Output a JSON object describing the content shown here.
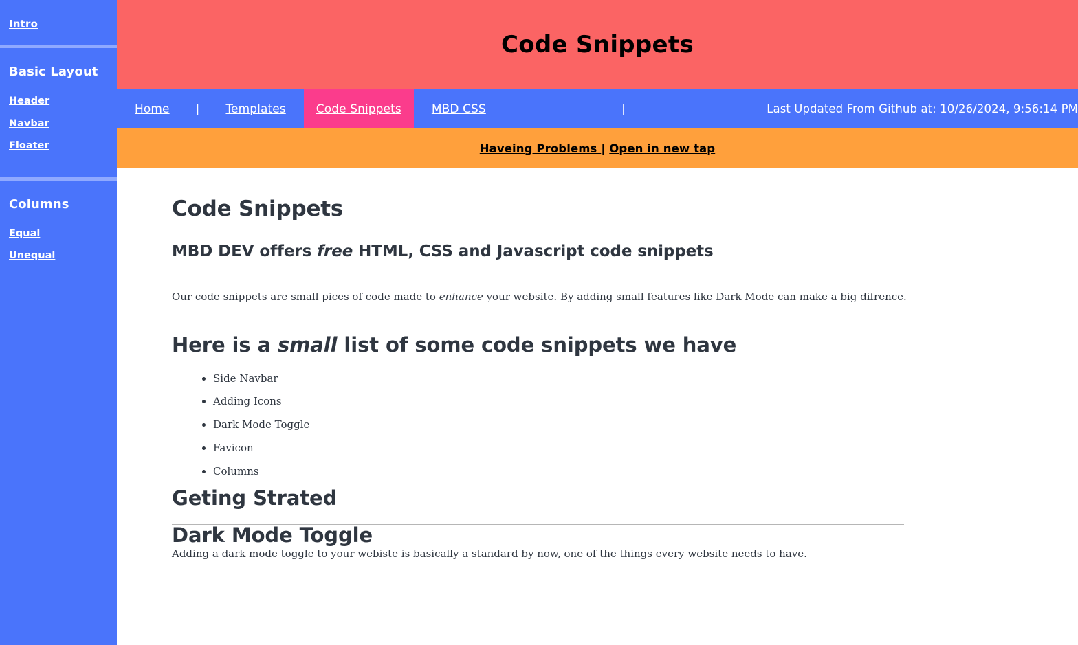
{
  "colors": {
    "sidebar_bg": "#4a74fb",
    "sidebar_divider": "#8fa9ff",
    "header_bg": "#fb6464",
    "navbar_bg": "#4a74fb",
    "nav_active_bg": "#fb3c8c",
    "banner_bg": "#ffa03c",
    "text_dark": "#2f3640",
    "rule": "#b6b6b6"
  },
  "sidebar": {
    "intro_label": "Intro",
    "groups": [
      {
        "heading": "Basic Layout",
        "items": [
          "Header",
          "Navbar",
          "Floater"
        ]
      },
      {
        "heading": "Columns",
        "items": [
          "Equal",
          "Unequal"
        ]
      }
    ]
  },
  "header": {
    "title": "Code Snippets"
  },
  "navbar": {
    "items": [
      {
        "label": "Home",
        "active": false
      },
      {
        "label": "|",
        "separator": true
      },
      {
        "label": "Templates",
        "active": false
      },
      {
        "label": "Code Snippets",
        "active": true
      },
      {
        "label": "MBD CSS",
        "active": false
      }
    ],
    "right_separator": "|",
    "last_updated": "Last Updated From Github at: 10/26/2024, 9:56:14 PM"
  },
  "banner": {
    "problems_text": "Haveing Problems ",
    "pipe": " | ",
    "open_text": "Open in new tap"
  },
  "main": {
    "page_title": "Code Snippets",
    "subtitle_before": "MBD DEV offers ",
    "subtitle_em": "free",
    "subtitle_after": " HTML, CSS and Javascript code snippets",
    "intro_before": "Our code snippets are small pices of code made to ",
    "intro_em": "enhance",
    "intro_after": " your website. By adding small features like Dark Mode can make a big difrence.",
    "list_heading_before": "Here is a ",
    "list_heading_em": "small",
    "list_heading_after": " list of some code snippets we have",
    "snippet_list": [
      "Side Navbar",
      "Adding Icons",
      "Dark Mode Toggle",
      "Favicon",
      "Columns"
    ],
    "getting_started_heading": "Geting Strated",
    "dark_mode_heading": "Dark Mode Toggle",
    "dark_mode_para": "Adding a dark mode toggle to your webiste is basically a standard by now, one of the things every website needs to have."
  }
}
